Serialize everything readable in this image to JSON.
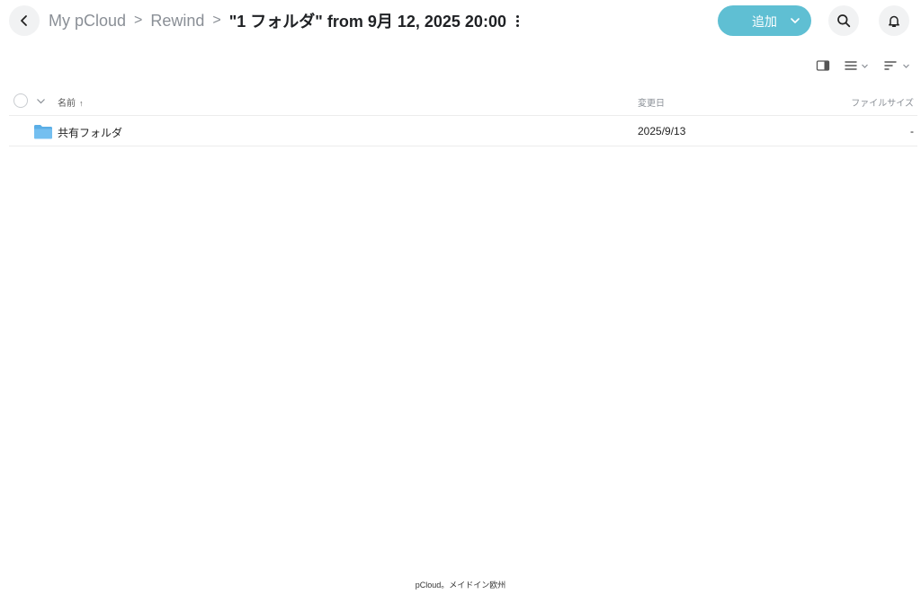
{
  "breadcrumb": {
    "items": [
      "My pCloud",
      "Rewind"
    ],
    "separator": ">",
    "current": "\"1 フォルダ\" from 9月 12, 2025 20:00"
  },
  "header": {
    "add_label": "追加",
    "icons": [
      "back-icon",
      "search-icon",
      "bell-icon",
      "more-vertical-icon",
      "chevron-down-icon"
    ]
  },
  "toolbar": {
    "icons": [
      "preview-panel-icon",
      "list-view-icon",
      "sort-icon"
    ]
  },
  "table": {
    "columns": {
      "name": "名前",
      "sort_arrow": "↑",
      "modified": "変更日",
      "size": "ファイルサイズ"
    },
    "rows": [
      {
        "name": "共有フォルダ",
        "modified": "2025/9/13",
        "size": "-",
        "type": "folder"
      }
    ]
  },
  "footer": {
    "text": "pCloud。メイドイン欧州"
  },
  "colors": {
    "accent": "#5fbfd3",
    "folder": "#5aaee6",
    "muted": "#8a8f96"
  }
}
